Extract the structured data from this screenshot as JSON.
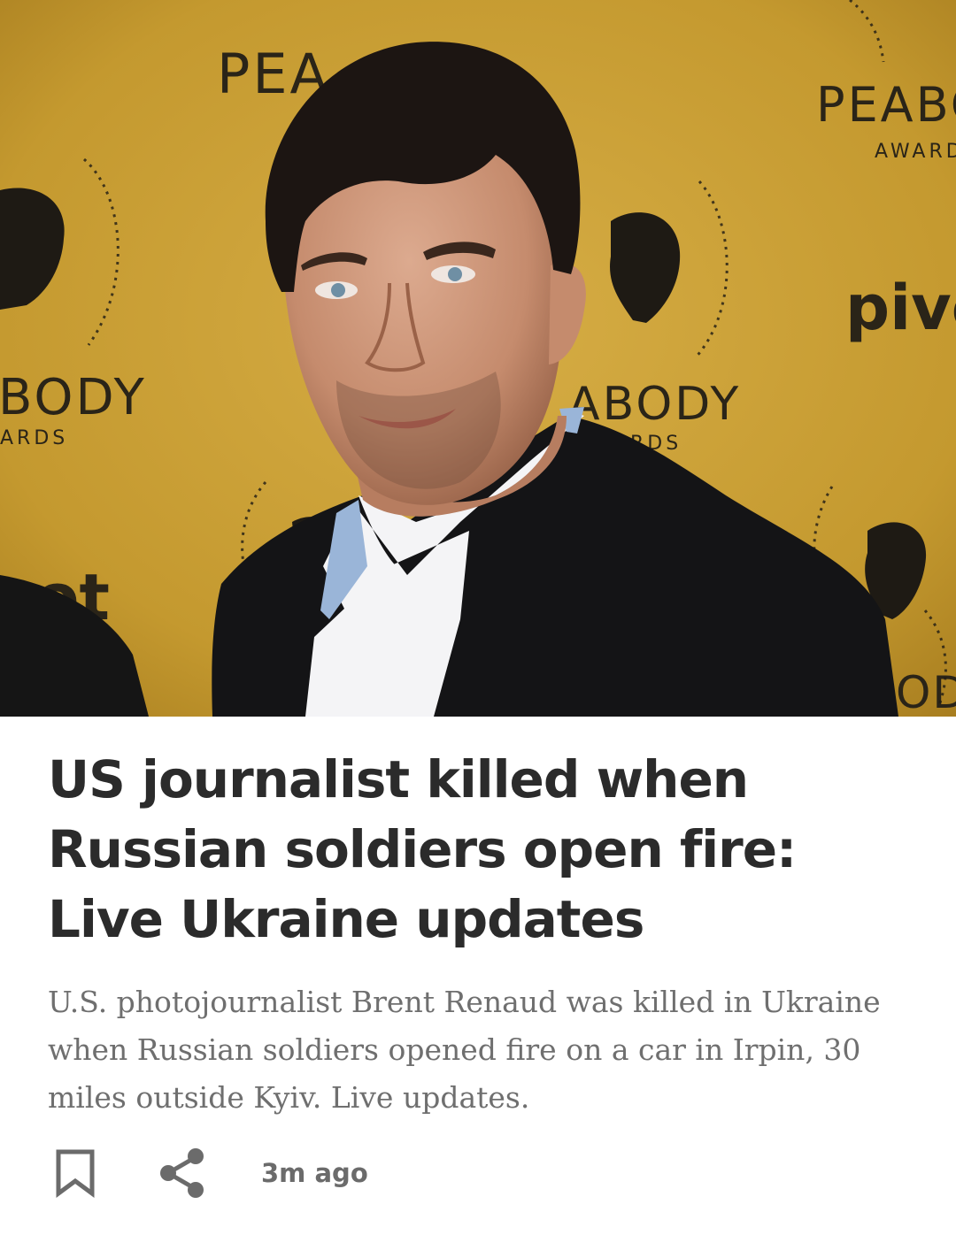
{
  "article": {
    "image": {
      "backdrop_words": [
        "PEA",
        "PEABC",
        "AWARD",
        "BODY",
        "ARDS",
        "ABODY",
        "RDS",
        "pivc",
        "ot",
        "OD"
      ],
      "backdrop_color": "#c4992f"
    },
    "headline": "US journalist killed when Russian soldiers open fire: Live Ukraine updates",
    "summary": "U.S. photojournalist Brent Renaud was killed in Ukraine when Russian soldiers opened fire on a car in Irpin, 30 miles outside Kyiv. Live updates.",
    "timestamp": "3m ago",
    "actions": {
      "bookmark_icon": "bookmark-icon",
      "share_icon": "share-icon"
    },
    "colors": {
      "headline": "#2b2b2b",
      "summary": "#6f6f6f",
      "meta": "#6b6b6b"
    }
  }
}
